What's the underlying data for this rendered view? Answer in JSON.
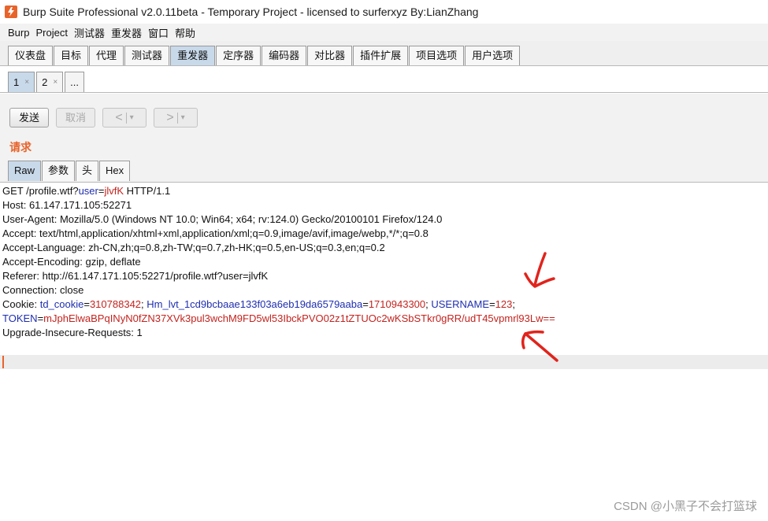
{
  "window": {
    "title": "Burp Suite Professional v2.0.11beta - Temporary Project - licensed to surferxyz By:LianZhang",
    "icon": "burp-logo-icon",
    "accent": "#e8632a"
  },
  "menu": [
    "Burp",
    "Project",
    "测试器",
    "重发器",
    "窗口",
    "帮助"
  ],
  "main_tabs": [
    {
      "label": "仪表盘"
    },
    {
      "label": "目标"
    },
    {
      "label": "代理"
    },
    {
      "label": "测试器"
    },
    {
      "label": "重发器",
      "active": true
    },
    {
      "label": "定序器"
    },
    {
      "label": "编码器"
    },
    {
      "label": "对比器"
    },
    {
      "label": "插件扩展"
    },
    {
      "label": "项目选项"
    },
    {
      "label": "用户选项"
    }
  ],
  "sub_tabs": [
    {
      "label": "1",
      "close": "×",
      "active": true
    },
    {
      "label": "2",
      "close": "×"
    },
    {
      "label": "..."
    }
  ],
  "toolbar": {
    "send": "发送",
    "cancel": "取消",
    "back": "<",
    "forward": ">",
    "dropdown": "▾"
  },
  "request": {
    "label": "请求",
    "view_tabs": [
      "Raw",
      "参数",
      "头",
      "Hex"
    ],
    "lines": {
      "l1": {
        "a": "GET /profile.wtf?",
        "b": "user",
        "c": "=",
        "d": "jlvfK",
        "e": " HTTP/1.1"
      },
      "l2": "Host: 61.147.171.105:52271",
      "l3": "User-Agent: Mozilla/5.0 (Windows NT 10.0; Win64; x64; rv:124.0) Gecko/20100101 Firefox/124.0",
      "l4": "Accept: text/html,application/xhtml+xml,application/xml;q=0.9,image/avif,image/webp,*/*;q=0.8",
      "l5": "Accept-Language: zh-CN,zh;q=0.8,zh-TW;q=0.7,zh-HK;q=0.5,en-US;q=0.3,en;q=0.2",
      "l6": "Accept-Encoding: gzip, deflate",
      "l7": "Referer: http://61.147.171.105:52271/profile.wtf?user=jlvfK",
      "l8": "Connection: close",
      "cookie": {
        "prefix": "Cookie: ",
        "k1": "td_cookie",
        "v1": "310788342",
        "k2": "Hm_lvt_1cd9bcbaae133f03a6eb19da6579aaba",
        "v2": "1710943300",
        "k3": "USERNAME",
        "v3": "123",
        "k4": "TOKEN",
        "v4": "mJphElwaBPqINyN0fZN37XVk3pul3wchM9FD5wl53IbckPVO02z1tZTUOc2wKSbSTkr0gRR/udT45vpmrl93Lw=="
      },
      "l11": "Upgrade-Insecure-Requests: 1"
    }
  },
  "watermark": "CSDN @小黑子不会打篮球",
  "annotation_color": "#e0241c"
}
